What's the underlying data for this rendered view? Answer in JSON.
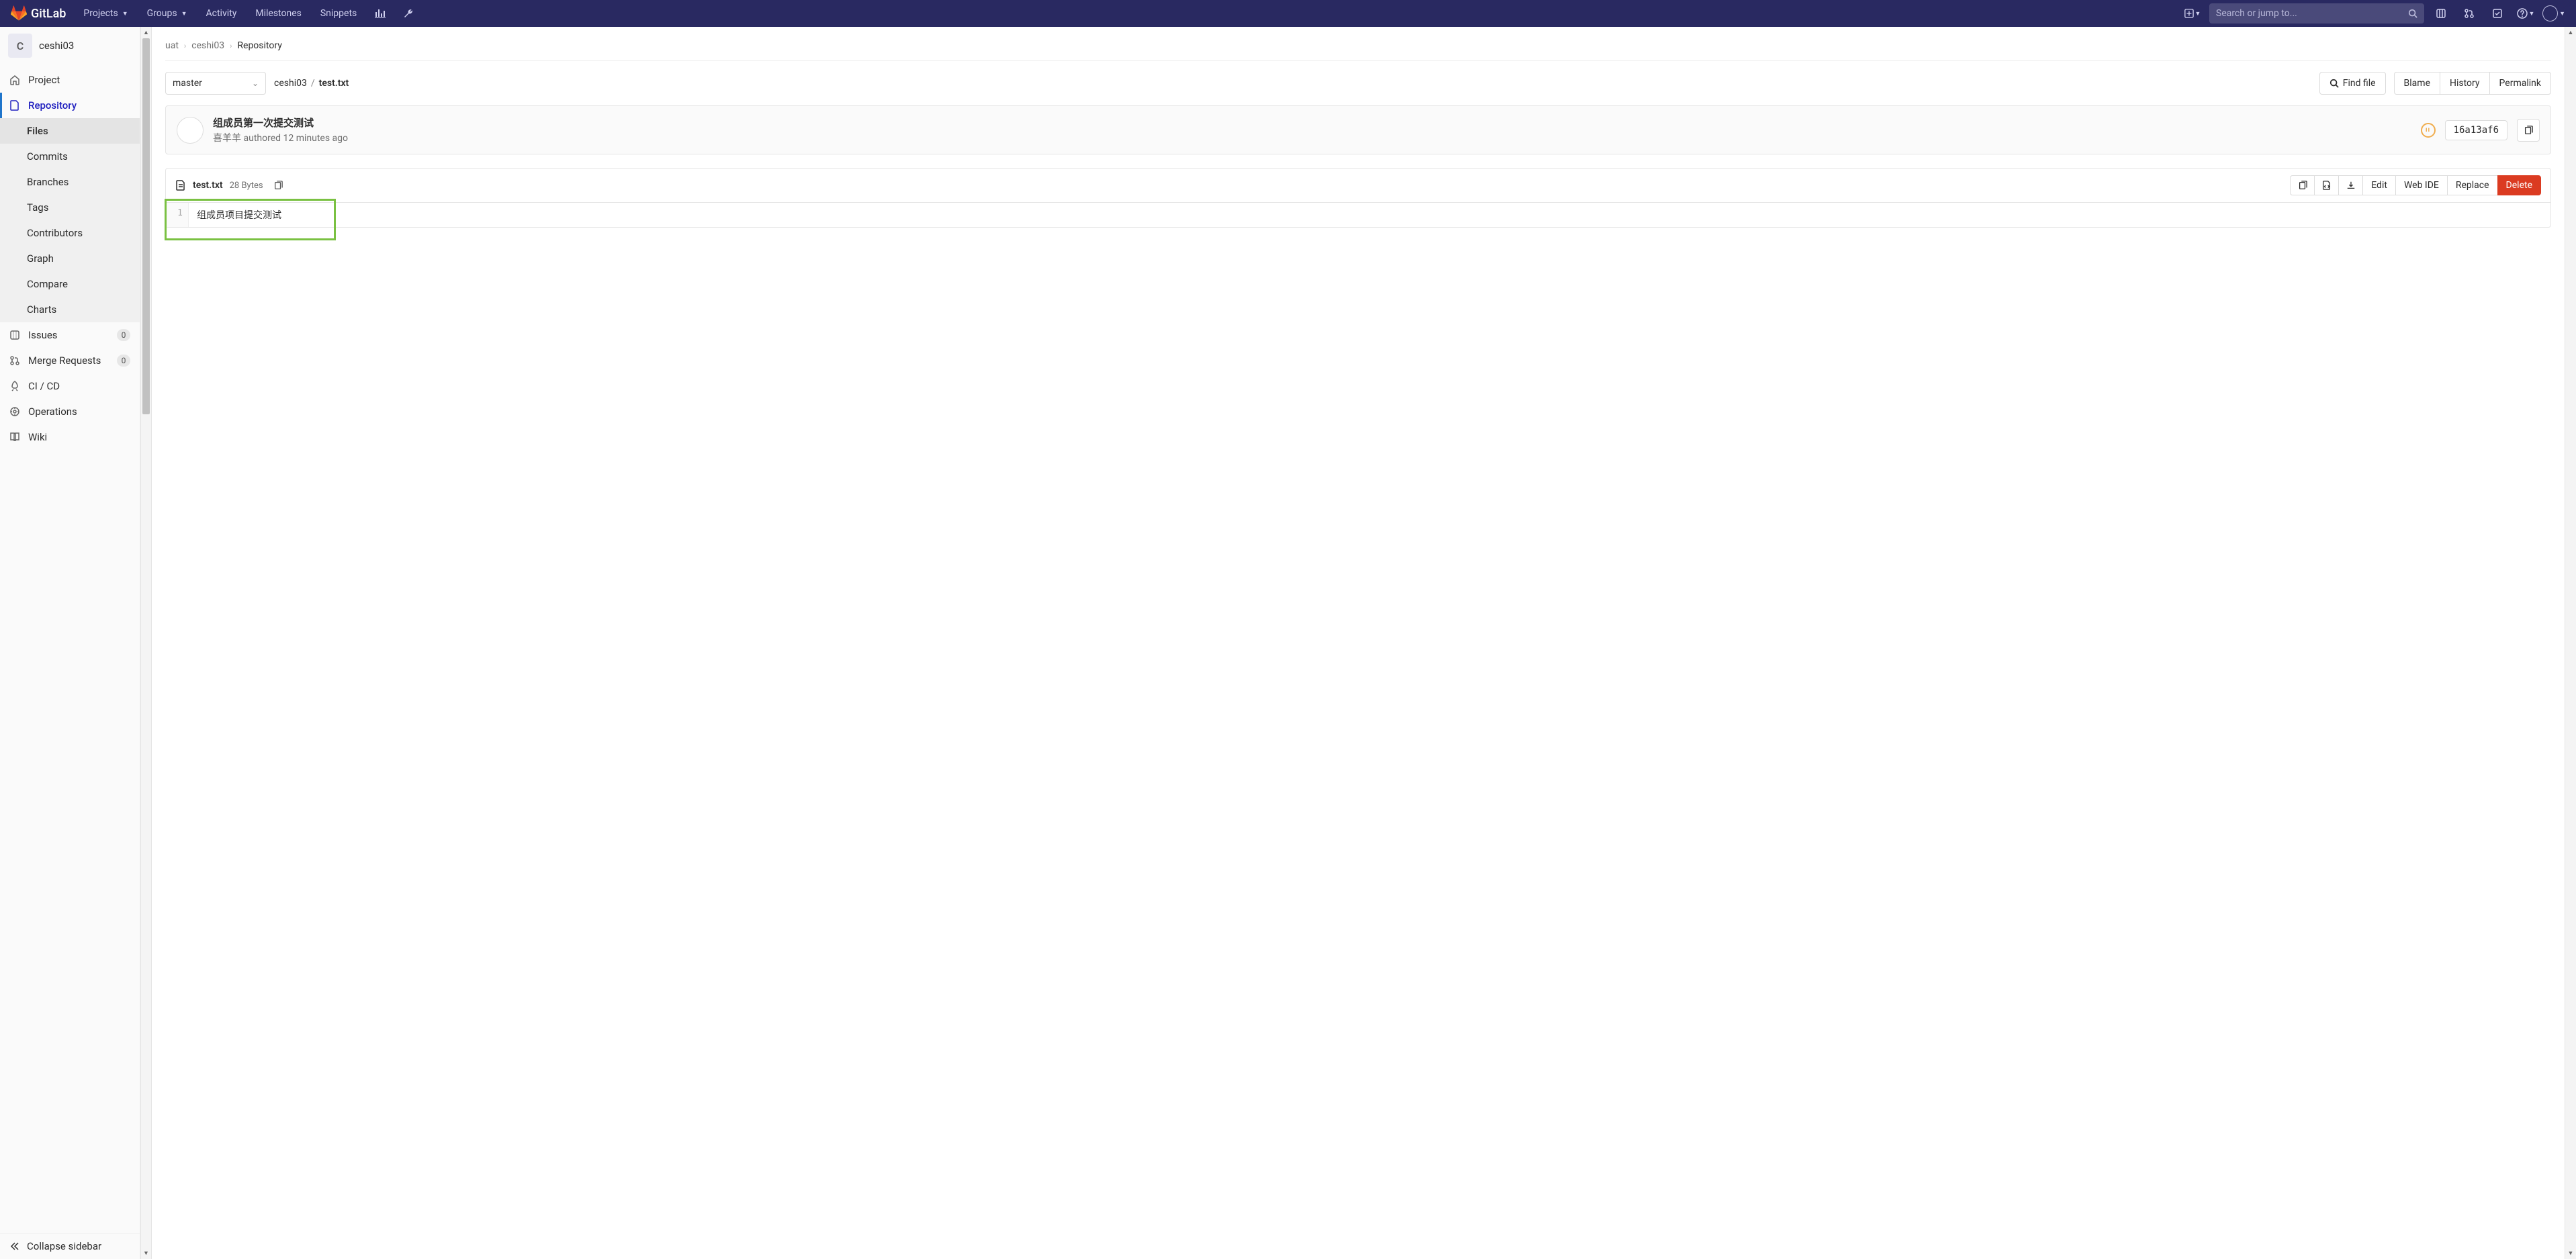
{
  "topnav": {
    "brand": "GitLab",
    "items": [
      "Projects",
      "Groups",
      "Activity",
      "Milestones",
      "Snippets"
    ],
    "search_placeholder": "Search or jump to..."
  },
  "sidebar": {
    "project_initial": "C",
    "project_name": "ceshi03",
    "nav": {
      "project": "Project",
      "repository": "Repository",
      "issues": "Issues",
      "issues_count": "0",
      "mrs": "Merge Requests",
      "mrs_count": "0",
      "cicd": "CI / CD",
      "operations": "Operations",
      "wiki": "Wiki"
    },
    "repo_sub": [
      "Files",
      "Commits",
      "Branches",
      "Tags",
      "Contributors",
      "Graph",
      "Compare",
      "Charts"
    ],
    "collapse": "Collapse sidebar"
  },
  "breadcrumbs": [
    "uat",
    "ceshi03",
    "Repository"
  ],
  "filebar": {
    "branch": "master",
    "path_project": "ceshi03",
    "path_file": "test.txt",
    "find_file": "Find file",
    "blame": "Blame",
    "history": "History",
    "permalink": "Permalink"
  },
  "commit": {
    "title": "组成员第一次提交测试",
    "author": "喜羊羊",
    "authored_word": "authored",
    "time": "12 minutes ago",
    "sha": "16a13af6"
  },
  "file": {
    "name": "test.txt",
    "size": "28 Bytes",
    "actions": {
      "edit": "Edit",
      "webide": "Web IDE",
      "replace": "Replace",
      "delete": "Delete"
    },
    "line_no": "1",
    "line": "组成员项目提交测试"
  }
}
